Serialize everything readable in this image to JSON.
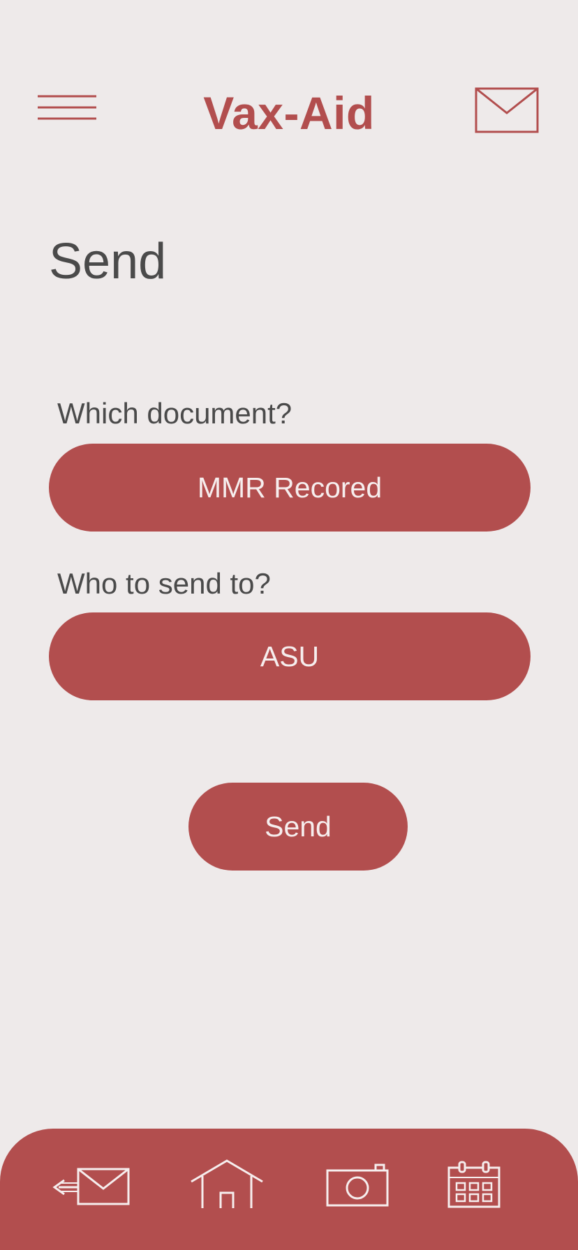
{
  "header": {
    "app_title": "Vax-Aid",
    "menu_icon": "hamburger-menu-icon",
    "mail_icon": "mail-icon"
  },
  "page": {
    "title": "Send"
  },
  "form": {
    "document_label": "Which document?",
    "document_value": "MMR Recored",
    "recipient_label": "Who to send to?",
    "recipient_value": "ASU",
    "send_label": "Send"
  },
  "bottom_nav": {
    "items": [
      {
        "icon": "send-mail-icon"
      },
      {
        "icon": "home-icon"
      },
      {
        "icon": "camera-icon"
      },
      {
        "icon": "calendar-icon"
      }
    ]
  },
  "colors": {
    "accent": "#b24e4e",
    "background": "#eeeaea",
    "text": "#4a4a4a",
    "on_accent": "#f6eeee"
  }
}
